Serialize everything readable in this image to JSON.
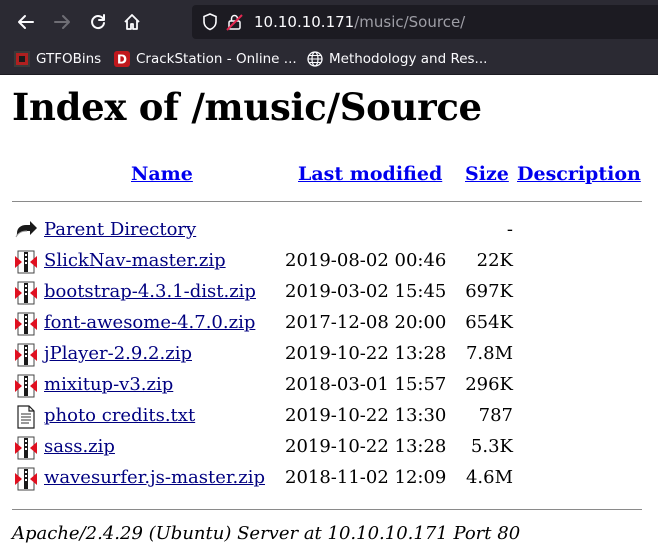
{
  "browser": {
    "url_host": "10.10.10.171",
    "url_path": "/music/Source/",
    "bookmarks": [
      {
        "label": "GTFOBins",
        "icon": "gtfobins-icon"
      },
      {
        "label": "CrackStation - Online ...",
        "icon": "crackstation-icon"
      },
      {
        "label": "Methodology and Res...",
        "icon": "globe-icon"
      }
    ]
  },
  "page": {
    "title": "Index of /music/Source",
    "columns": {
      "name": "Name",
      "last_modified": "Last modified",
      "size": "Size",
      "description": "Description"
    },
    "parent": {
      "name": "Parent Directory",
      "size": "-"
    },
    "files": [
      {
        "name": "SlickNav-master.zip",
        "date": "2019-08-02 00:46",
        "size": "22K",
        "icon": "compressed-file-icon"
      },
      {
        "name": "bootstrap-4.3.1-dist.zip",
        "date": "2019-03-02 15:45",
        "size": "697K",
        "icon": "compressed-file-icon"
      },
      {
        "name": "font-awesome-4.7.0.zip",
        "date": "2017-12-08 20:00",
        "size": "654K",
        "icon": "compressed-file-icon"
      },
      {
        "name": "jPlayer-2.9.2.zip",
        "date": "2019-10-22 13:28",
        "size": "7.8M",
        "icon": "compressed-file-icon"
      },
      {
        "name": "mixitup-v3.zip",
        "date": "2018-03-01 15:57",
        "size": "296K",
        "icon": "compressed-file-icon"
      },
      {
        "name": "photo credits.txt",
        "date": "2019-10-22 13:30",
        "size": "787",
        "icon": "text-file-icon"
      },
      {
        "name": "sass.zip",
        "date": "2019-10-22 13:28",
        "size": "5.3K",
        "icon": "compressed-file-icon"
      },
      {
        "name": "wavesurfer.js-master.zip",
        "date": "2018-11-02 12:09",
        "size": "4.6M",
        "icon": "compressed-file-icon"
      }
    ],
    "footer": "Apache/2.4.29 (Ubuntu) Server at 10.10.10.171 Port 80"
  }
}
